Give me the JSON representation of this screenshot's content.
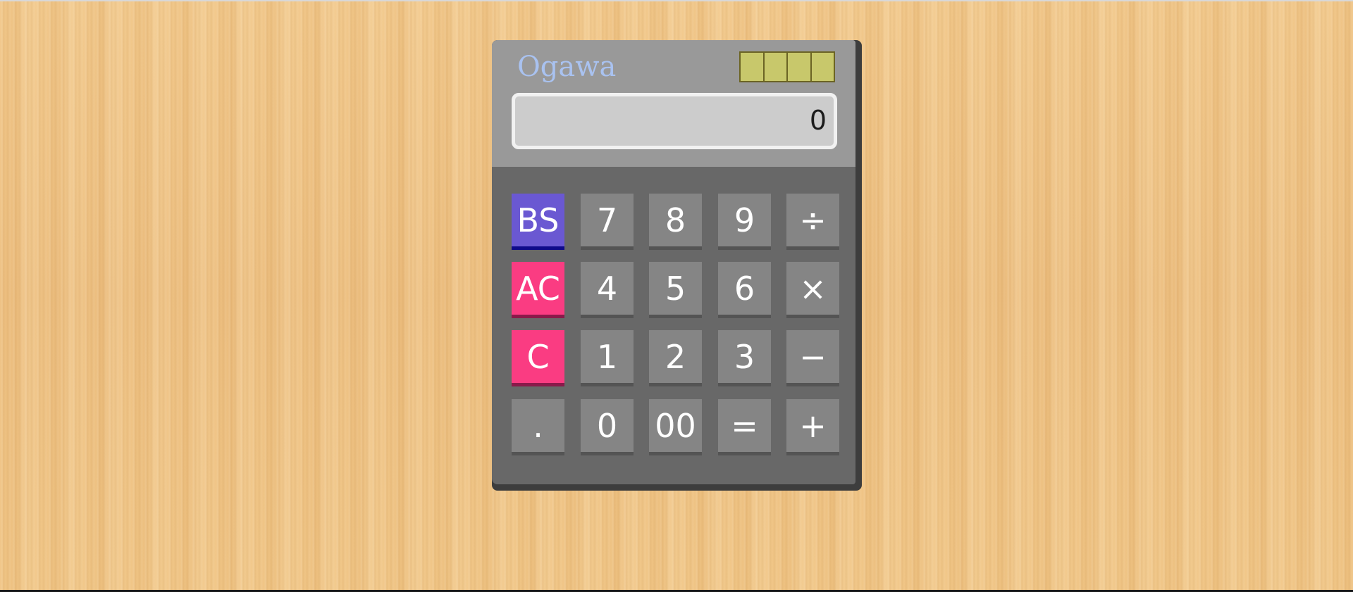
{
  "calculator": {
    "brand": "Ogawa",
    "display_value": "0",
    "keys": [
      [
        "BS",
        "7",
        "8",
        "9",
        "÷"
      ],
      [
        "AC",
        "4",
        "5",
        "6",
        "×"
      ],
      [
        "C",
        "1",
        "2",
        "3",
        "−"
      ],
      [
        ".",
        "0",
        "00",
        "=",
        "+"
      ]
    ]
  },
  "colors": {
    "background": "#efc383",
    "body": "#686868",
    "top_panel": "#999999",
    "display": "#cccccc",
    "brand_text": "#a9c2f0",
    "solar_panel": "#c8c86b",
    "key": "#858585",
    "backspace_key": "#6a58d2",
    "clear_key": "#fa3c82"
  }
}
